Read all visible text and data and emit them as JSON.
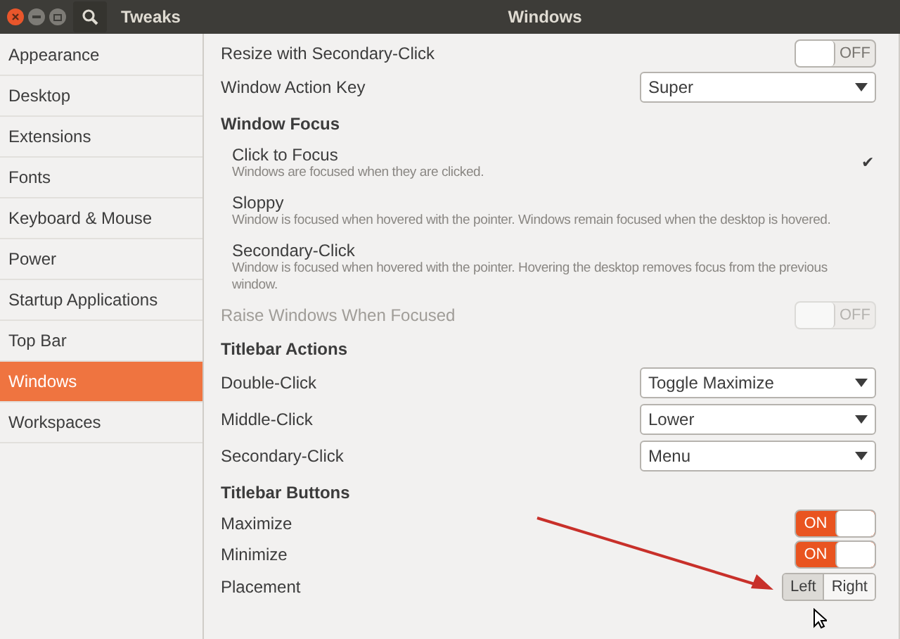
{
  "window": {
    "app_title": "Tweaks",
    "title": "Windows"
  },
  "sidebar": {
    "items": [
      {
        "label": "Appearance",
        "selected": false
      },
      {
        "label": "Desktop",
        "selected": false
      },
      {
        "label": "Extensions",
        "selected": false
      },
      {
        "label": "Fonts",
        "selected": false
      },
      {
        "label": "Keyboard & Mouse",
        "selected": false
      },
      {
        "label": "Power",
        "selected": false
      },
      {
        "label": "Startup Applications",
        "selected": false
      },
      {
        "label": "Top Bar",
        "selected": false
      },
      {
        "label": "Windows",
        "selected": true
      },
      {
        "label": "Workspaces",
        "selected": false
      }
    ]
  },
  "check_mark": "✔",
  "rows": [
    {
      "kind": "switch",
      "label": "Resize with Secondary-Click",
      "on": false,
      "disabled": false,
      "text": "OFF"
    },
    {
      "kind": "dropdown",
      "label": "Window Action Key",
      "value": "Super"
    },
    {
      "kind": "heading",
      "label": "Window Focus"
    },
    {
      "kind": "radio",
      "label": "Click to Focus",
      "description": "Windows are focused when they are clicked.",
      "selected": true
    },
    {
      "kind": "radio",
      "label": "Sloppy",
      "description": "Window is focused when hovered with the pointer. Windows remain focused when the desktop is hovered.",
      "selected": false
    },
    {
      "kind": "radio",
      "label": "Secondary-Click",
      "description": "Window is focused when hovered with the pointer. Hovering the desktop removes focus from the previous window.",
      "selected": false
    },
    {
      "kind": "switch",
      "label": "Raise Windows When Focused",
      "on": false,
      "disabled": true,
      "text": "OFF"
    },
    {
      "kind": "heading",
      "label": "Titlebar Actions"
    },
    {
      "kind": "dropdown",
      "label": "Double-Click",
      "value": "Toggle Maximize"
    },
    {
      "kind": "dropdown",
      "label": "Middle-Click",
      "value": "Lower"
    },
    {
      "kind": "dropdown",
      "label": "Secondary-Click",
      "value": "Menu"
    },
    {
      "kind": "heading",
      "label": "Titlebar Buttons"
    },
    {
      "kind": "switch",
      "label": "Maximize",
      "on": true,
      "disabled": false,
      "text": "ON"
    },
    {
      "kind": "switch",
      "label": "Minimize",
      "on": true,
      "disabled": false,
      "text": "ON"
    },
    {
      "kind": "segmented",
      "label": "Placement",
      "options": [
        {
          "label": "Left",
          "selected": true
        },
        {
          "label": "Right",
          "selected": false
        }
      ]
    }
  ]
}
